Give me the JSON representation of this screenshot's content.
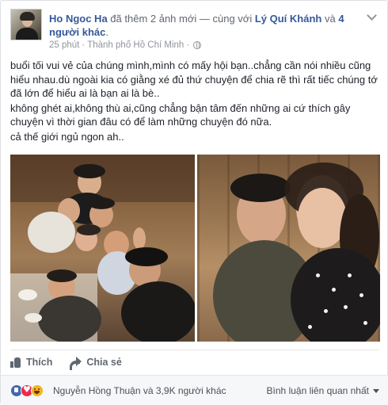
{
  "post": {
    "author": "Ho Ngoc Ha",
    "action_text": "đã thêm 2 ảnh mới — cùng với",
    "tagged_name": "Lý Quí Khánh",
    "tagged_joiner": "và",
    "tagged_others": "4 người khác",
    "tagged_end": ".",
    "time": "25 phút",
    "separator": "·",
    "location": "Thành phố Hồ Chí Minh",
    "separator2": "·",
    "privacy_icon": "globe-icon",
    "menu_icon": "chevron-down-icon",
    "body": [
      "buổi tối vui vẻ của chúng mình,mình có mấy hội bạn..chẳng cần nói nhiều cũng hiểu nhau.dù ngoài kia có giằng xé đủ thứ chuyện để chia rẽ thì rất tiếc chúng tớ đã lớn để hiểu ai là bạn ai là bè..",
      "không ghét ai,không thù ai,cũng chẳng bận tâm đến những ai cứ thích gây chuyện vì thời gian đâu có để làm những chuyện đó nữa.",
      "cả thế giới ngủ ngon ah.."
    ]
  },
  "actions": {
    "like_label": "Thích",
    "share_label": "Chia sẻ",
    "like_icon": "thumbs-up-icon",
    "share_icon": "share-arrow-icon"
  },
  "reactions": {
    "icons": [
      "like-reaction-icon",
      "love-reaction-icon",
      "haha-reaction-icon"
    ],
    "name": "Nguyễn Hồng Thuận",
    "joiner": "và",
    "count_text": "3,9K người khác",
    "comment_filter": "Bình luận liên quan nhất"
  },
  "colors": {
    "link": "#365899",
    "meta": "#90949c",
    "like_blue": "#4267b2",
    "love_red": "#f0284a",
    "haha_yellow": "#f7b125"
  }
}
